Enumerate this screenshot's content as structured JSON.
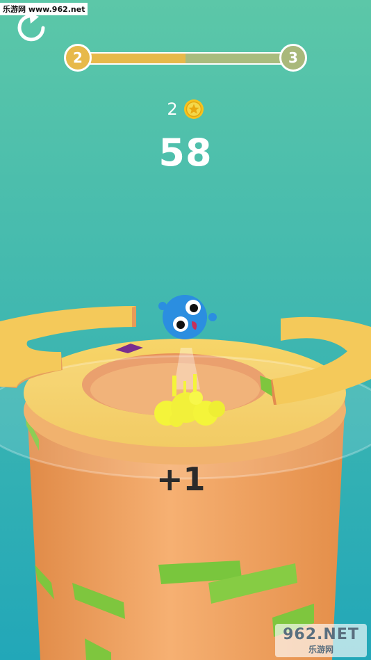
{
  "watermark": {
    "top_text": "乐游网 www.962.net",
    "brand": "962.NET",
    "brand_sub": "乐游网"
  },
  "hud": {
    "restart_icon": "restart-icon",
    "level_current": "2",
    "level_next": "3",
    "level_progress": 0.5,
    "coin_count": "2",
    "coin_icon": "star-coin-icon",
    "score": "58",
    "bonus_popup": "+1"
  },
  "colors": {
    "background_top": "#5cc7a8",
    "background_bottom": "#22a7b8",
    "tower": "#f0a45d",
    "platform": "#f4c95a",
    "safe_segment": "#7ec63e",
    "danger_segment": "#7a2e8f",
    "ball": "#2b8ee0",
    "splash": "#f4f43a"
  }
}
